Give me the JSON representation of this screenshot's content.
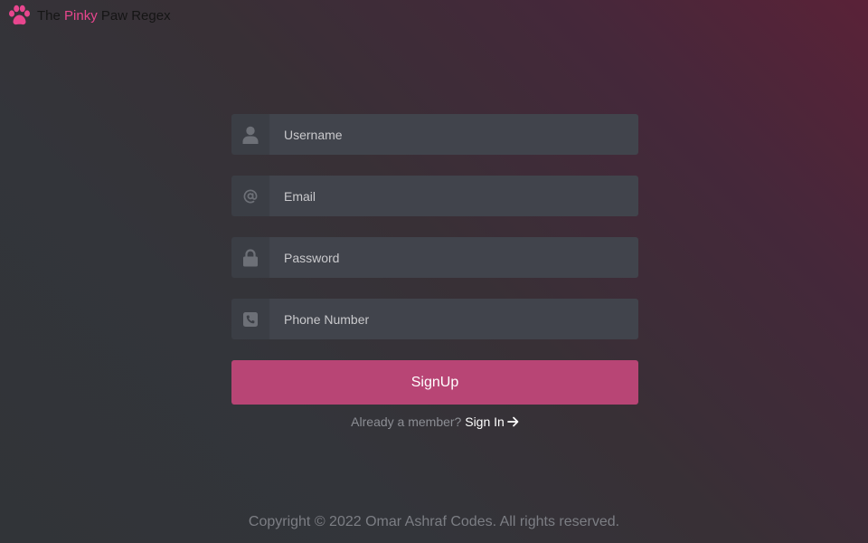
{
  "brand": {
    "prefix": "The ",
    "highlight": "Pinky",
    "suffix": " Paw Regex",
    "icon": "paw-icon",
    "highlight_color": "#e8468e"
  },
  "form": {
    "username": {
      "placeholder": "Username",
      "icon": "user-icon"
    },
    "email": {
      "placeholder": "Email",
      "icon": "at-icon"
    },
    "password": {
      "placeholder": "Password",
      "icon": "lock-icon"
    },
    "phone": {
      "placeholder": "Phone Number",
      "icon": "phone-icon"
    },
    "submit_label": "SignUp",
    "submit_color": "#b84575"
  },
  "signin": {
    "prompt": "Already a member?",
    "link_label": "Sign In",
    "icon": "arrow-right-icon"
  },
  "footer": {
    "copyright": "Copyright © 2022 Omar Ashraf Codes. All rights reserved."
  }
}
